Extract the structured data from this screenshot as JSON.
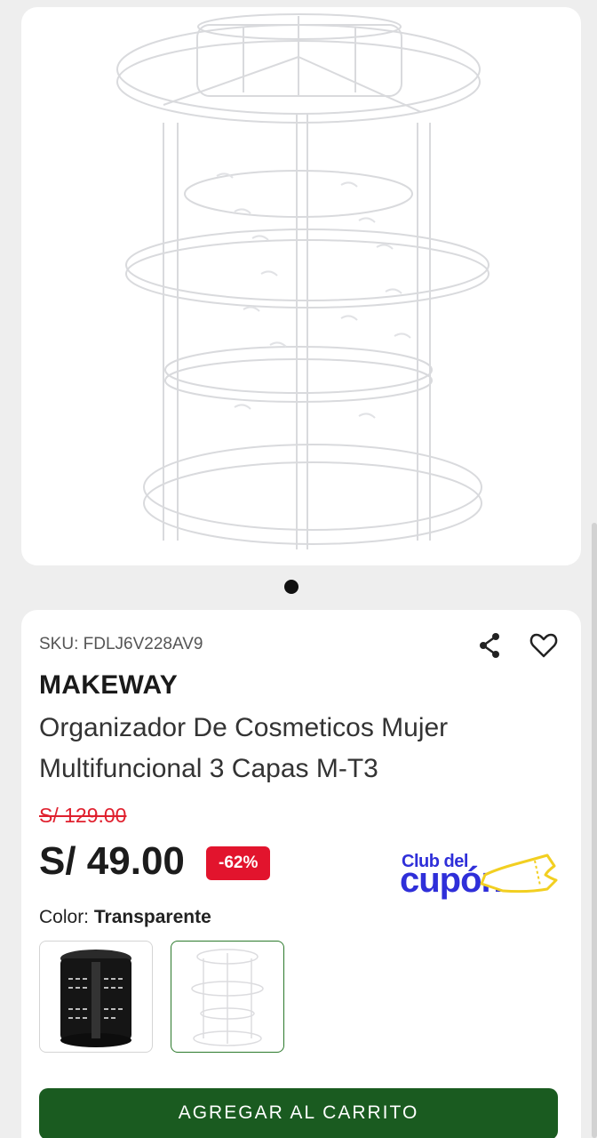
{
  "product": {
    "image_alt": "clear-rotating-organizer",
    "carousel_dots": 1,
    "sku_label": "SKU: FDLJ6V228AV9",
    "brand": "MAKEWAY",
    "title": "Organizador De Cosmeticos Mujer Multifuncional 3 Capas M-T3",
    "old_price": "S/ 129.00",
    "price": "S/ 49.00",
    "discount": "-62%"
  },
  "promo": {
    "line1": "Club del",
    "line2": "cupón"
  },
  "color": {
    "label": "Color:",
    "selected": "Transparente",
    "options": [
      "black-organizer",
      "transparent-organizer"
    ]
  },
  "actions": {
    "add_to_cart": "AGREGAR AL CARRITO"
  },
  "colors": {
    "accent_green": "#1a5b20",
    "discount_red": "#e2142d",
    "promo_blue": "#2f2fd9"
  },
  "icons": {
    "share": "share-icon",
    "favorite": "heart-icon"
  }
}
